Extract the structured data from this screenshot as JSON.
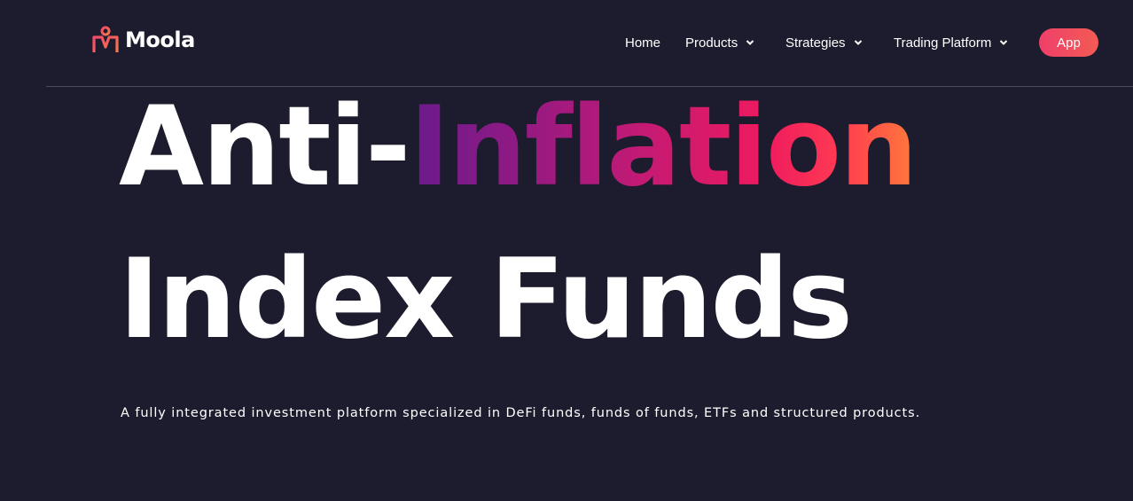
{
  "brand": {
    "name": "Moola",
    "logo_icon": "moola-logo-icon",
    "colors": {
      "logo_start": "#f04a6a",
      "logo_end": "#f57a4a"
    }
  },
  "nav": {
    "items": [
      {
        "label": "Home",
        "has_dropdown": false
      },
      {
        "label": "Products",
        "has_dropdown": true,
        "icon": "chevron-down-icon"
      },
      {
        "label": "Strategies",
        "has_dropdown": true,
        "icon": "chevron-down-icon"
      },
      {
        "label": "Trading Platform",
        "has_dropdown": true,
        "icon": "chevron-down-icon"
      }
    ],
    "app_button": "App"
  },
  "hero": {
    "line1_plain": "Anti-",
    "line1_highlight": "Inflation",
    "line2": "Index Funds",
    "subtitle": "A fully integrated investment platform specialized in DeFi funds, funds of funds, ETFs and structured products."
  },
  "colors": {
    "background": "#1c1c2e",
    "text": "#ffffff",
    "accent_gradient_start": "#6a1a8c",
    "accent_gradient_end": "#ff7a3a",
    "app_button": "#ef3f6a"
  }
}
